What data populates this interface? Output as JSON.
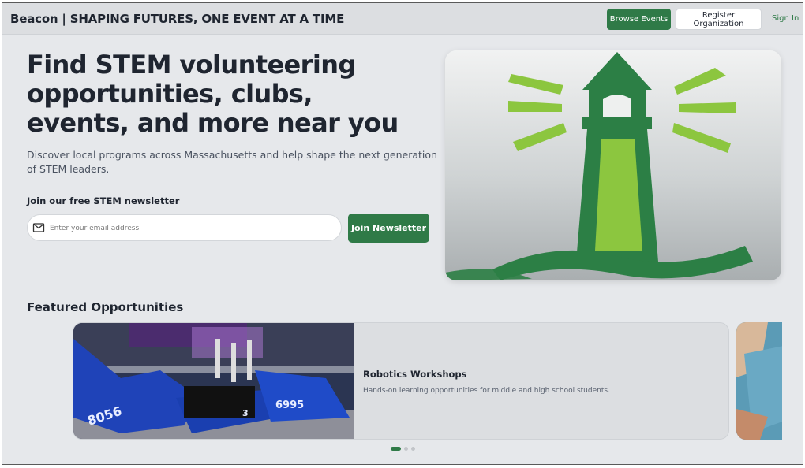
{
  "header": {
    "brand": "Beacon | SHAPING FUTURES, ONE EVENT AT A TIME",
    "browse_label": "Browse Events",
    "register_label": "Register Organization",
    "signin_label": "Sign In"
  },
  "hero": {
    "title": "Find STEM volunteering opportunities, clubs, events, and more near you",
    "description": "Discover local programs across Massachusetts and help shape the next generation of STEM leaders.",
    "newsletter_label": "Join our free STEM newsletter",
    "email_placeholder": "Enter your email address",
    "join_label": "Join Newsletter",
    "logo_icon": "lighthouse-logo"
  },
  "featured": {
    "title": "Featured Opportunities",
    "cards": [
      {
        "title": "Robotics Workshops",
        "description": "Hands-on learning opportunities for middle and high school students.",
        "robot_numbers": [
          "8056",
          "6995",
          "3"
        ]
      }
    ],
    "dots": {
      "count": 3,
      "active": 0
    }
  },
  "colors": {
    "accent": "#2f7a47",
    "logo_dark": "#2c7f45",
    "logo_light": "#8cc63f",
    "background": "#e6e8eb"
  }
}
